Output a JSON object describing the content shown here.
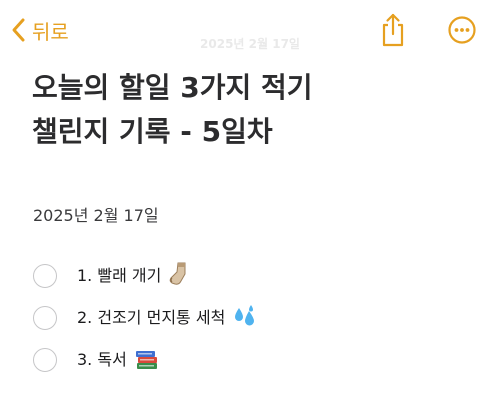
{
  "nav": {
    "back_label": "뒤로",
    "title": "2025년 2월 17일",
    "accent_color": "#e6a020"
  },
  "note": {
    "title_line1": "오늘의 할일 3가지 적기",
    "title_line2": "챌린지 기록 - 5일차",
    "date": "2025년 2월 17일",
    "checklist": [
      {
        "text": "1. 빨래 개기",
        "emoji": "sock-emoji",
        "checked": false
      },
      {
        "text": "2. 건조기 먼지통 세척",
        "emoji": "sweat-droplets-emoji",
        "checked": false
      },
      {
        "text": "3. 독서",
        "emoji": "books-emoji",
        "checked": false
      }
    ]
  }
}
